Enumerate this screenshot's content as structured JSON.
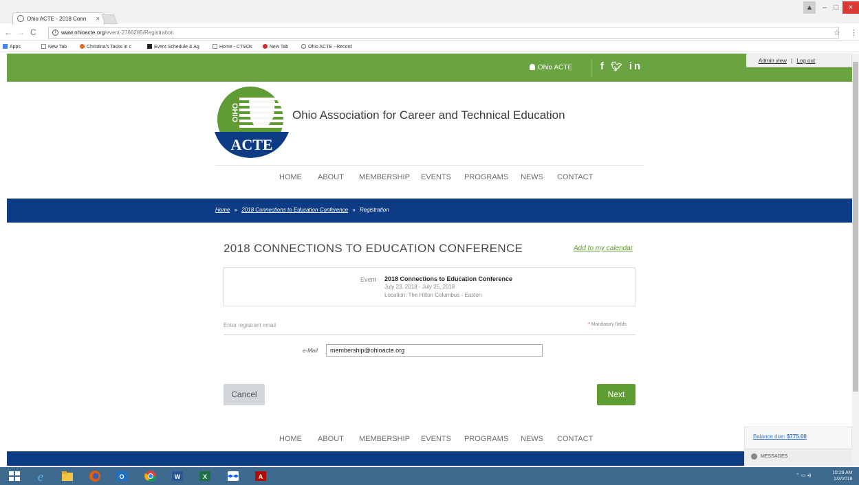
{
  "browser": {
    "tab_title": "Ohio ACTE - 2018 Conn",
    "url_host": "www.ohioacte.org",
    "url_path": "/event-2766285/Registration",
    "bookmarks": [
      "Apps",
      "New Tab",
      "Christina's Tasks in c",
      "Event Schedule & Ag",
      "Home - CTSOs",
      "New Tab",
      "Ohio ACTE - Record"
    ]
  },
  "site": {
    "user_link": "Ohio ACTE",
    "socials": "f  𝕏 in",
    "admin_view": "Admin view",
    "separator": "|",
    "logout": "Log out",
    "logo_state": "OHIO",
    "logo_acronym": "ACTE",
    "org_name": "Ohio Association for Career and Technical Education",
    "nav": [
      "HOME",
      "ABOUT",
      "MEMBERSHIP",
      "EVENTS",
      "PROGRAMS",
      "NEWS",
      "CONTACT"
    ]
  },
  "breadcrumb": {
    "home": "Home",
    "sep1": "»",
    "event": "2018 Connections to Education Conference",
    "sep2": "»",
    "current": "Registration"
  },
  "event": {
    "page_title": "2018 CONNECTIONS TO EDUCATION CONFERENCE",
    "add_calendar": "Add to my calendar",
    "label": "Event",
    "name": "2018 Connections to Education Conference",
    "dates": "July 23, 2018 - July 25, 2018",
    "location": "Location: The Hilton Columbus - Easton"
  },
  "form": {
    "section_label": "Enter registrant email",
    "mandatory_star": "*",
    "mandatory_text": "Mandatory fields",
    "email_label": "e-Mail",
    "email_value": "membership@ohioacte.org",
    "cancel": "Cancel",
    "next": "Next"
  },
  "panel": {
    "balance_label": "Balance due:",
    "balance_value": "$775.00",
    "messages": "MESSAGES"
  },
  "taskbar": {
    "time": "10:29 AM",
    "date": "2/2/2018"
  },
  "colors": {
    "brand_green": "#6aa342",
    "brand_blue": "#0d3c85",
    "button_green": "#5f9c33"
  }
}
